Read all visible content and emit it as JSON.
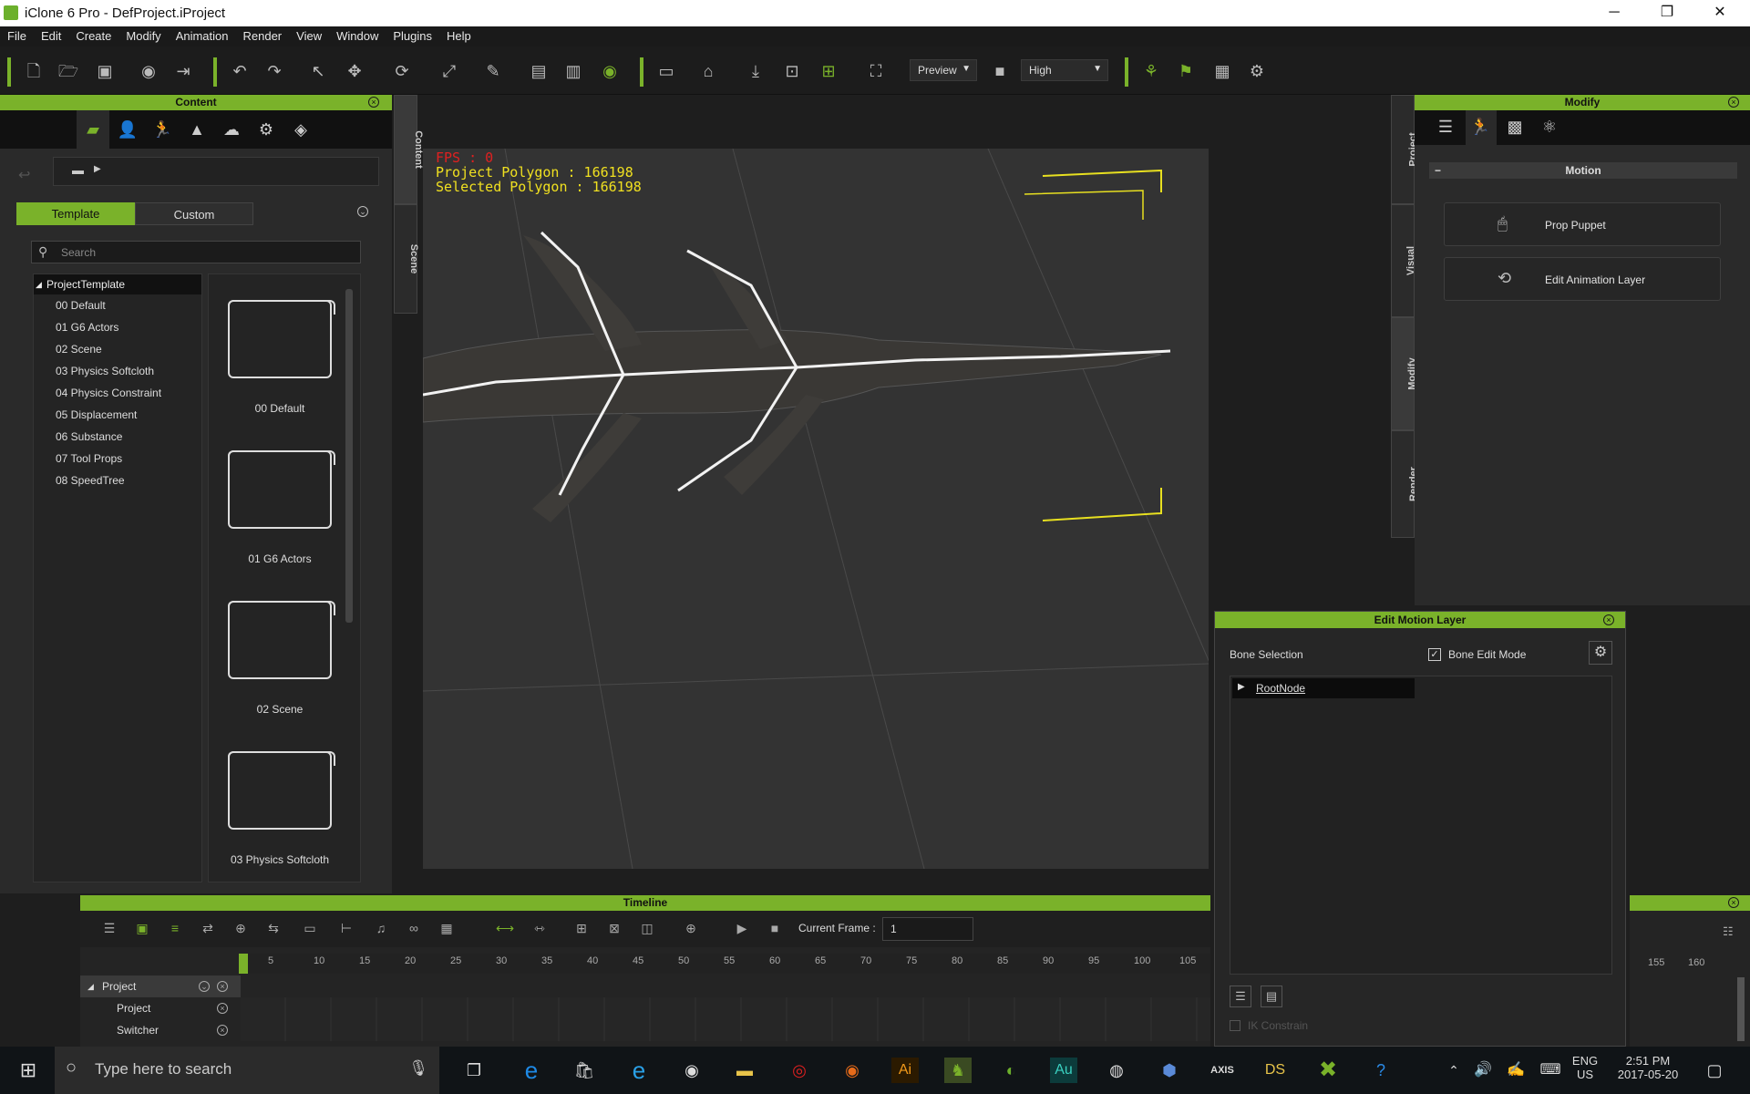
{
  "window": {
    "title": "iClone 6 Pro - DefProject.iProject",
    "min": "─",
    "max": "❐",
    "close": "✕"
  },
  "menu": [
    "File",
    "Edit",
    "Create",
    "Modify",
    "Animation",
    "Render",
    "View",
    "Window",
    "Plugins",
    "Help"
  ],
  "toolbar": {
    "preview_label": "Preview",
    "quality_label": "High"
  },
  "content_panel": {
    "title": "Content",
    "side_tabs": [
      "Content",
      "Scene"
    ],
    "tabs": {
      "template": "Template",
      "custom": "Custom"
    },
    "search_placeholder": "Search",
    "tree": {
      "root": "ProjectTemplate",
      "items": [
        "00 Default",
        "01 G6 Actors",
        "02 Scene",
        "03 Physics Softcloth",
        "04 Physics Constraint",
        "05 Displacement",
        "06 Substance",
        "07 Tool Props",
        "08 SpeedTree"
      ]
    },
    "thumbs": [
      "00 Default",
      "01 G6 Actors",
      "02 Scene",
      "03 Physics Softcloth"
    ]
  },
  "viewport": {
    "fps": "FPS : 0",
    "project_polygon": "Project Polygon : 166198",
    "selected_polygon": "Selected Polygon : 166198"
  },
  "right_side_tabs": [
    "Project",
    "Visual",
    "Modify",
    "Render"
  ],
  "modify_panel": {
    "title": "Modify",
    "section": "Motion",
    "buttons": [
      "Prop Puppet",
      "Edit Animation Layer"
    ]
  },
  "edit_motion_layer": {
    "title": "Edit Motion Layer",
    "bone_selection": "Bone Selection",
    "bone_edit_mode": "Bone Edit Mode",
    "root_node": "RootNode",
    "ik_constrain": "IK Constrain"
  },
  "timeline": {
    "title": "Timeline",
    "current_frame_label": "Current Frame :",
    "current_frame_value": "1",
    "ticks": [
      "5",
      "10",
      "15",
      "20",
      "25",
      "30",
      "35",
      "40",
      "45",
      "50",
      "55",
      "60",
      "65",
      "70",
      "75",
      "80",
      "85",
      "90",
      "95",
      "100",
      "105"
    ],
    "right_ticks": [
      "155",
      "160"
    ],
    "tracks": [
      "Project",
      "Project",
      "Switcher"
    ]
  },
  "taskbar": {
    "search_placeholder": "Type here to search",
    "lang": "ENG",
    "region": "US",
    "time": "2:51 PM",
    "date": "2017-05-20"
  },
  "colors": {
    "accent": "#7ab22a",
    "hud_fps": "#e02020",
    "hud_text": "#f0e020"
  }
}
